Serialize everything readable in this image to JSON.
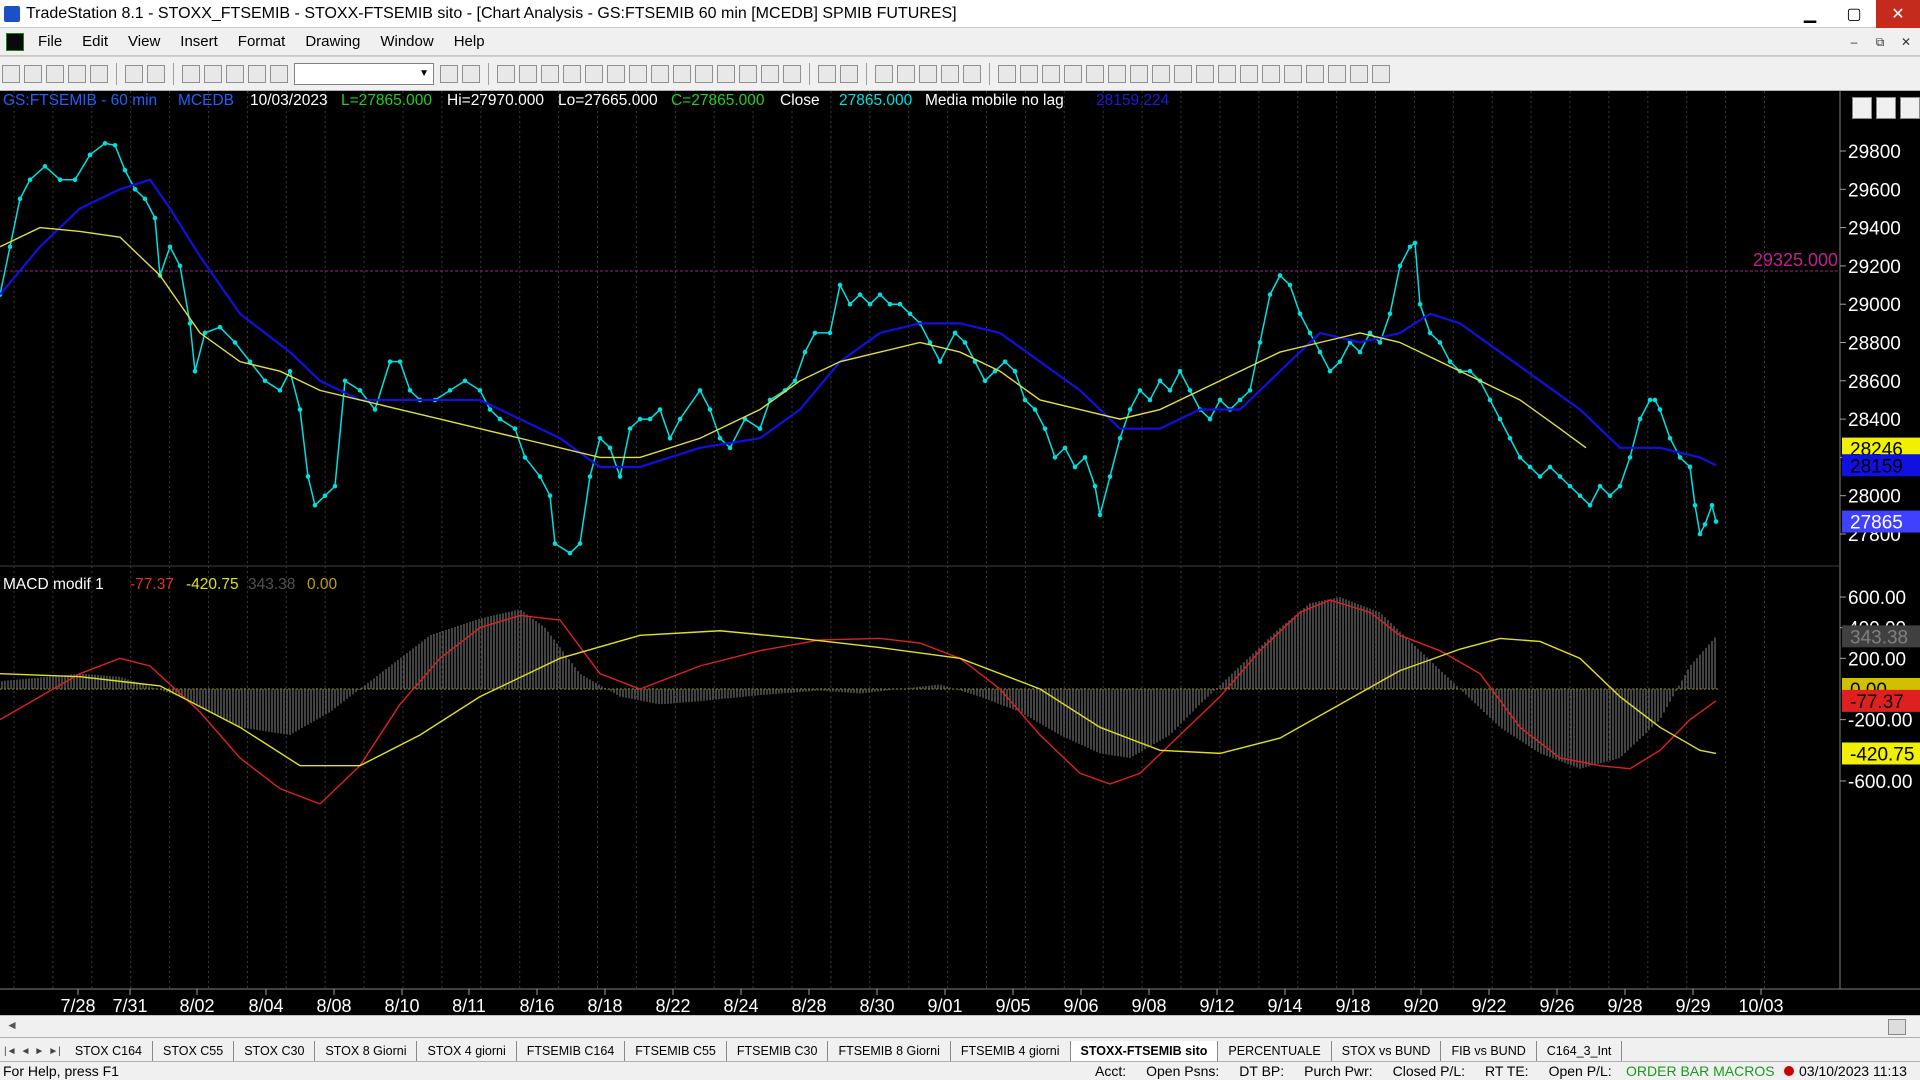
{
  "window": {
    "title": "TradeStation 8.1 - STOXX_FTSEMIB - STOXX-FTSEMIB sito - [Chart Analysis - GS:FTSEMIB  60 min  [MCEDB] SPMIB FUTURES]",
    "minimize": "▁",
    "maximize": "▢",
    "close": "✕"
  },
  "menu": {
    "items": [
      "File",
      "Edit",
      "View",
      "Insert",
      "Format",
      "Drawing",
      "Window",
      "Help"
    ],
    "mdi_min": "–",
    "mdi_restore": "⧉",
    "mdi_close": "✕"
  },
  "toolbar": {
    "combo_arrow": "▼"
  },
  "chart": {
    "header": {
      "symbol": "GS:FTSEMIB - 60 min",
      "exchange": "MCEDB",
      "date": "10/03/2023",
      "last": "L=27865.000",
      "high": "Hi=27970.000",
      "low": "Lo=27665.000",
      "close": "C=27865.000",
      "close_label": "Close",
      "close_value": "27865.000",
      "indicator": "Media mobile no lag",
      "indicator_value": "28159.224"
    },
    "hline_label": "29325.000",
    "price_ticks": [
      "29800",
      "29600",
      "29400",
      "29200",
      "29000",
      "28800",
      "28600",
      "28400",
      "28200",
      "28000",
      "27800"
    ],
    "price_badges": {
      "yellow": "28246",
      "blue": "28159",
      "last": "27865"
    },
    "macd_header": {
      "name": "MACD modif 1",
      "v1": "-77.37",
      "v2": "-420.75",
      "v3": "343.38",
      "v4": "0.00"
    },
    "macd_ticks": [
      "600.00",
      "400.00",
      "200.00",
      "-200.00",
      "-600.00"
    ],
    "macd_badges": {
      "hist": "343.38",
      "zero": "0.00",
      "red": "-77.37",
      "yellow": "-420.75"
    },
    "date_ticks": [
      "7/28",
      "7/31",
      "8/02",
      "8/04",
      "8/08",
      "8/10",
      "8/11",
      "8/16",
      "8/18",
      "8/22",
      "8/24",
      "8/28",
      "8/30",
      "9/01",
      "9/05",
      "9/06",
      "9/08",
      "9/12",
      "9/14",
      "9/18",
      "9/20",
      "9/22",
      "9/26",
      "9/28",
      "9/29",
      "10/03"
    ],
    "colors": {
      "price": "#00e0e0",
      "ma_blue": "#1010e0",
      "ma_yellow": "#e0e040",
      "macd_red": "#e02020",
      "macd_yellow": "#e0e020",
      "hist": "#707070",
      "hline": "#a0208a"
    }
  },
  "tabs": {
    "nav": [
      "|◄",
      "◄",
      "►",
      "►|"
    ],
    "items": [
      "STOX C164",
      "STOX C55",
      "STOX  C30",
      "STOX  8 Giorni",
      "STOX 4 giorni",
      "FTSEMIB C164",
      "FTSEMIB C55",
      "FTSEMIB C30",
      "FTSEMIB  8 Giorni",
      "FTSEMIB  4 giorni",
      "STOXX-FTSEMIB sito",
      "PERCENTUALE",
      "STOX vs BUND",
      "FIB vs BUND",
      "C164_3_Int"
    ],
    "active_index": 10
  },
  "status": {
    "help": "For Help, press F1",
    "fields": [
      "Acct:",
      "Open Psns:",
      "DT BP:",
      "Purch Pwr:",
      "Closed P/L:",
      "RT TE:",
      "Open P/L:"
    ],
    "order_bar": "ORDER BAR  MACROS",
    "datetime": "03/10/2023 11:13"
  }
}
